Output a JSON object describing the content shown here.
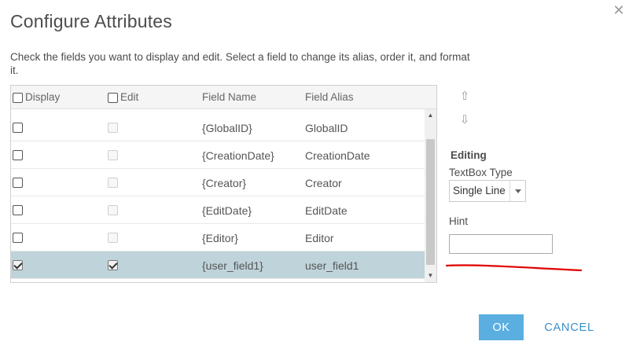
{
  "dialog": {
    "title": "Configure Attributes",
    "description": "Check the fields you want to display and edit. Select a field to change its alias, order it, and format it.",
    "close_icon": "close-icon"
  },
  "table": {
    "headers": {
      "display": "Display",
      "edit": "Edit",
      "field_name": "Field Name",
      "field_alias": "Field Alias"
    },
    "rows": [
      {
        "field_name": "{GlobalID}",
        "field_alias": "GlobalID",
        "display": false,
        "edit": false,
        "edit_enabled": false,
        "selected": false
      },
      {
        "field_name": "{CreationDate}",
        "field_alias": "CreationDate",
        "display": false,
        "edit": false,
        "edit_enabled": false,
        "selected": false
      },
      {
        "field_name": "{Creator}",
        "field_alias": "Creator",
        "display": false,
        "edit": false,
        "edit_enabled": false,
        "selected": false
      },
      {
        "field_name": "{EditDate}",
        "field_alias": "EditDate",
        "display": false,
        "edit": false,
        "edit_enabled": false,
        "selected": false
      },
      {
        "field_name": "{Editor}",
        "field_alias": "Editor",
        "display": false,
        "edit": false,
        "edit_enabled": false,
        "selected": false
      },
      {
        "field_name": "{user_field1}",
        "field_alias": "user_field1",
        "display": true,
        "edit": true,
        "edit_enabled": true,
        "selected": true
      }
    ]
  },
  "ordering": {
    "move_up_icon": "arrow-up-icon",
    "move_down_icon": "arrow-down-icon"
  },
  "editing": {
    "section_title": "Editing",
    "textbox_type_label": "TextBox Type",
    "textbox_type_value": "Single Line",
    "hint_label": "Hint",
    "hint_value": ""
  },
  "footer": {
    "ok_label": "OK",
    "cancel_label": "CANCEL"
  },
  "colors": {
    "accent": "#5aaee0",
    "selected_row": "#bfd3da",
    "annotation": "#e00000"
  }
}
